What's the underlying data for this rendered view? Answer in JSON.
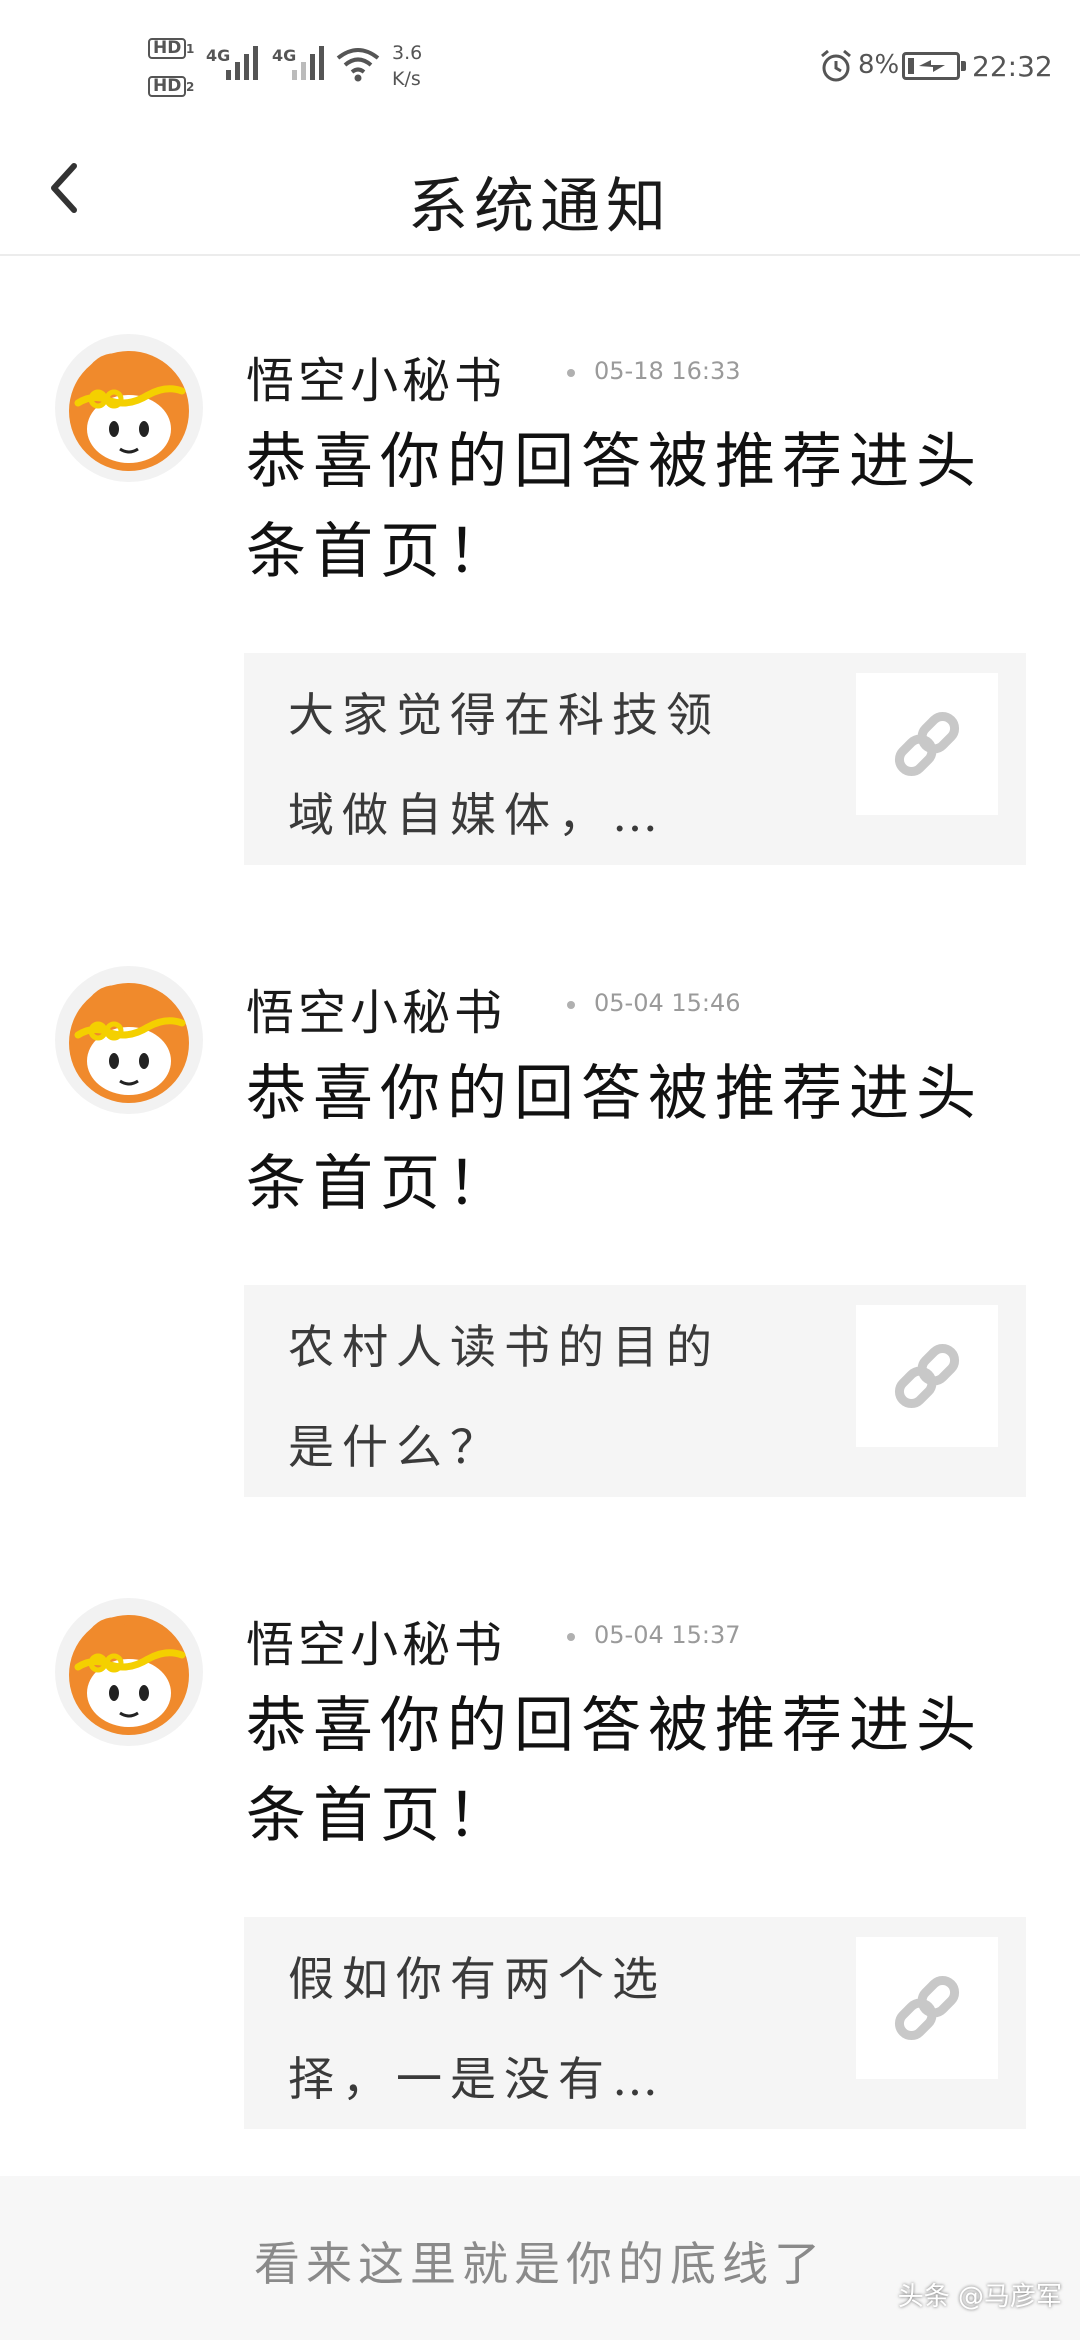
{
  "status_bar": {
    "hd1": "HD",
    "hd1_num": "1",
    "hd2": "HD",
    "hd2_num": "2",
    "net1": "4G",
    "net2": "4G",
    "speed_value": "3.6",
    "speed_unit": "K/s",
    "battery_percent": "8%",
    "time": "22:32",
    "icons": [
      "signal-icon",
      "wifi-icon",
      "alarm-icon",
      "battery-charging-icon"
    ]
  },
  "header": {
    "title": "系统通知",
    "back_icon": "chevron-left-icon"
  },
  "notifications": [
    {
      "sender": "悟空小秘书",
      "timestamp": "05-18 16:33",
      "message": "恭喜你的回答被推荐进头条首页！",
      "card_text": "大家觉得在科技领域做自媒体，…",
      "link_icon": "link-icon"
    },
    {
      "sender": "悟空小秘书",
      "timestamp": "05-04 15:46",
      "message": "恭喜你的回答被推荐进头条首页！",
      "card_text": "农村人读书的目的是什么？",
      "link_icon": "link-icon"
    },
    {
      "sender": "悟空小秘书",
      "timestamp": "05-04 15:37",
      "message": "恭喜你的回答被推荐进头条首页！",
      "card_text": "假如你有两个选择，一是没有…",
      "link_icon": "link-icon"
    }
  ],
  "footer": {
    "end_text": "看来这里就是你的底线了",
    "watermark": "头条 @马彦军"
  },
  "colors": {
    "avatar_orange": "#f08a2c",
    "card_bg": "#f5f5f5",
    "footer_bg": "#f7f7f7",
    "timestamp_gray": "#9a9a9a"
  }
}
